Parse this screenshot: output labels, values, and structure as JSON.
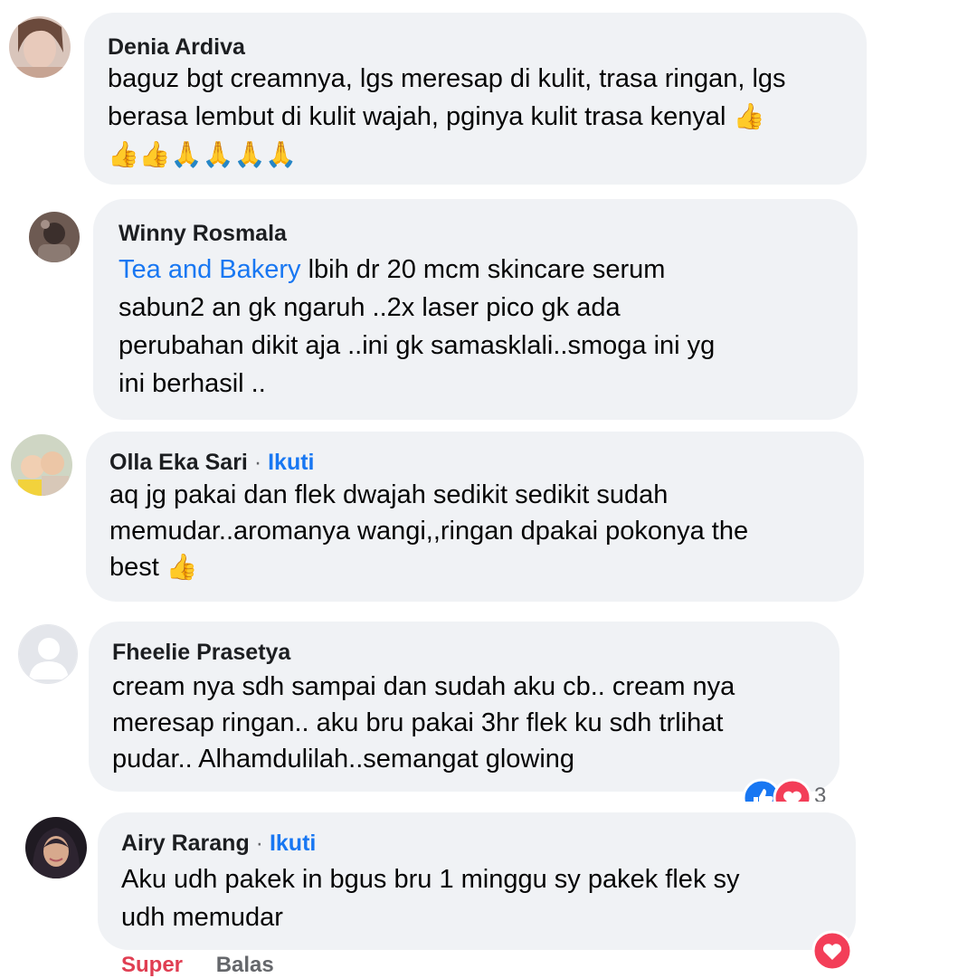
{
  "comments": [
    {
      "name": "Denia Ardiva",
      "follow": "",
      "link_text": "",
      "lines": [
        "baguz bgt creamnya, lgs meresap di kulit, trasa ringan, lgs",
        "berasa lembut di kulit wajah, pginya kulit trasa kenyal"
      ],
      "emoji_name": "thumbs-up-and-folded-hands"
    },
    {
      "name": "Winny Rosmala",
      "follow": "",
      "link_text": "Tea and Bakery",
      "lines": [
        " lbih dr 20 mcm skincare serum",
        "sabun2 an gk ngaruh ..2x laser pico gk ada",
        "perubahan dikit aja ..ini gk samasklali..smoga ini yg",
        "ini berhasil .."
      ]
    },
    {
      "name": "Olla Eka Sari",
      "follow": "Ikuti",
      "link_text": "",
      "lines": [
        "aq jg pakai dan flek dwajah sedikit sedikit sudah",
        "memudar..aromanya wangi,,ringan dpakai pokonya the",
        "best"
      ],
      "emoji_name": "thumbs-up"
    },
    {
      "name": "Fheelie Prasetya",
      "follow": "",
      "link_text": "",
      "lines": [
        "cream nya sdh sampai dan sudah aku cb.. cream nya",
        "meresap ringan.. aku bru pakai 3hr flek ku sdh trlihat",
        "pudar.. Alhamdulilah..semangat glowing"
      ],
      "reactions": {
        "count": "3",
        "icons": [
          "like",
          "love"
        ]
      }
    },
    {
      "name": "Airy Rarang",
      "follow": "Ikuti",
      "link_text": "",
      "lines": [
        "Aku udh pakek in bgus bru 1 minggu sy pakek flek sy",
        "udh memudar"
      ],
      "reactions": {
        "icons": [
          "love"
        ]
      }
    }
  ],
  "separator": "·",
  "actions": {
    "super": "Super",
    "reply": "Balas"
  },
  "colors": {
    "bubble": "#f0f2f5",
    "link": "#1877f2",
    "super": "#e03e52",
    "action": "#65676b",
    "love": "#f33e58",
    "like": "#1877f2"
  }
}
